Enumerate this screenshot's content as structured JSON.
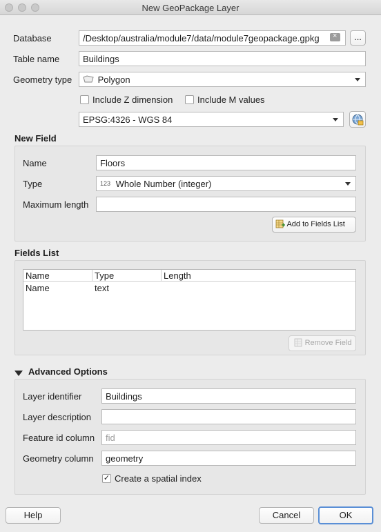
{
  "window": {
    "title": "New GeoPackage Layer"
  },
  "database": {
    "label": "Database",
    "value": "/Desktop/australia/module7/data/module7geopackage.gpkg",
    "browse_label": "..."
  },
  "table_name": {
    "label": "Table name",
    "value": "Buildings"
  },
  "geometry_type": {
    "label": "Geometry type",
    "value": "Polygon"
  },
  "options": {
    "include_z": "Include Z dimension",
    "include_m": "Include M values"
  },
  "crs": {
    "value": "EPSG:4326 - WGS 84"
  },
  "new_field": {
    "title": "New Field",
    "name_label": "Name",
    "name_value": "Floors",
    "type_label": "Type",
    "type_prefix": "123",
    "type_value": "Whole Number (integer)",
    "maxlen_label": "Maximum length",
    "maxlen_value": "",
    "add_button": "Add to Fields List"
  },
  "fields_list": {
    "title": "Fields List",
    "columns": [
      "Name",
      "Type",
      "Length"
    ],
    "rows": [
      {
        "name": "Name",
        "type": "text",
        "length": ""
      }
    ],
    "remove_button": "Remove Field"
  },
  "advanced": {
    "title": "Advanced Options",
    "layer_identifier_label": "Layer identifier",
    "layer_identifier_value": "Buildings",
    "layer_description_label": "Layer description",
    "layer_description_value": "",
    "feature_id_label": "Feature id column",
    "feature_id_placeholder": "fid",
    "geometry_column_label": "Geometry column",
    "geometry_column_value": "geometry",
    "spatial_index_label": "Create a spatial index",
    "spatial_index_checked": true
  },
  "buttons": {
    "help": "Help",
    "cancel": "Cancel",
    "ok": "OK"
  }
}
